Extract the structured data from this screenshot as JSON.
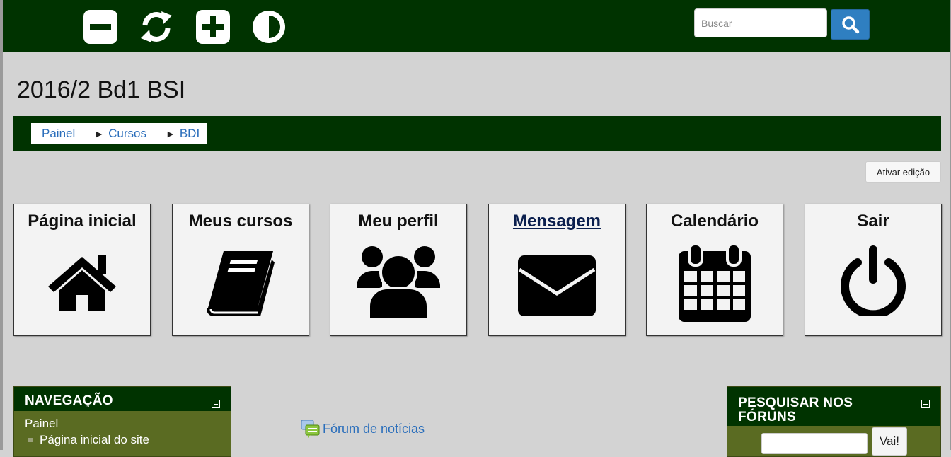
{
  "accessibility_toolbar": {
    "buttons": [
      {
        "icon": "decrease-font-icon"
      },
      {
        "icon": "reset-icon"
      },
      {
        "icon": "increase-font-icon"
      },
      {
        "icon": "contrast-icon"
      }
    ]
  },
  "search": {
    "placeholder": "Buscar",
    "value": "",
    "button_icon": "search-icon"
  },
  "page": {
    "title": "2016/2 Bd1 BSI"
  },
  "breadcrumb": {
    "items": [
      "Painel",
      "Cursos",
      "BDI"
    ],
    "separator": "►"
  },
  "edit_button": {
    "label": "Ativar edição"
  },
  "tiles": [
    {
      "label": "Página inicial",
      "icon": "home-icon"
    },
    {
      "label": "Meus cursos",
      "icon": "book-icon"
    },
    {
      "label": "Meu perfil",
      "icon": "users-icon"
    },
    {
      "label": "Mensagem",
      "icon": "envelope-icon"
    },
    {
      "label": "Calendário",
      "icon": "calendar-icon"
    },
    {
      "label": "Sair",
      "icon": "power-icon"
    }
  ],
  "navigation_block": {
    "title": "NAVEGAÇÃO",
    "items": [
      "Painel",
      "Página inicial do site"
    ]
  },
  "forum_link": {
    "label": "Fórum de notícias",
    "icon": "forum-icon"
  },
  "forum_search_block": {
    "title": "PESQUISAR NOS FÓRUNS",
    "input_value": "",
    "go_label": "Vai!"
  },
  "colors": {
    "header_bg": "#003300",
    "block_bg": "#5a6b22",
    "page_bg": "#d3d3d3",
    "link": "#2a6ebb",
    "search_button": "#2f7fc1"
  }
}
